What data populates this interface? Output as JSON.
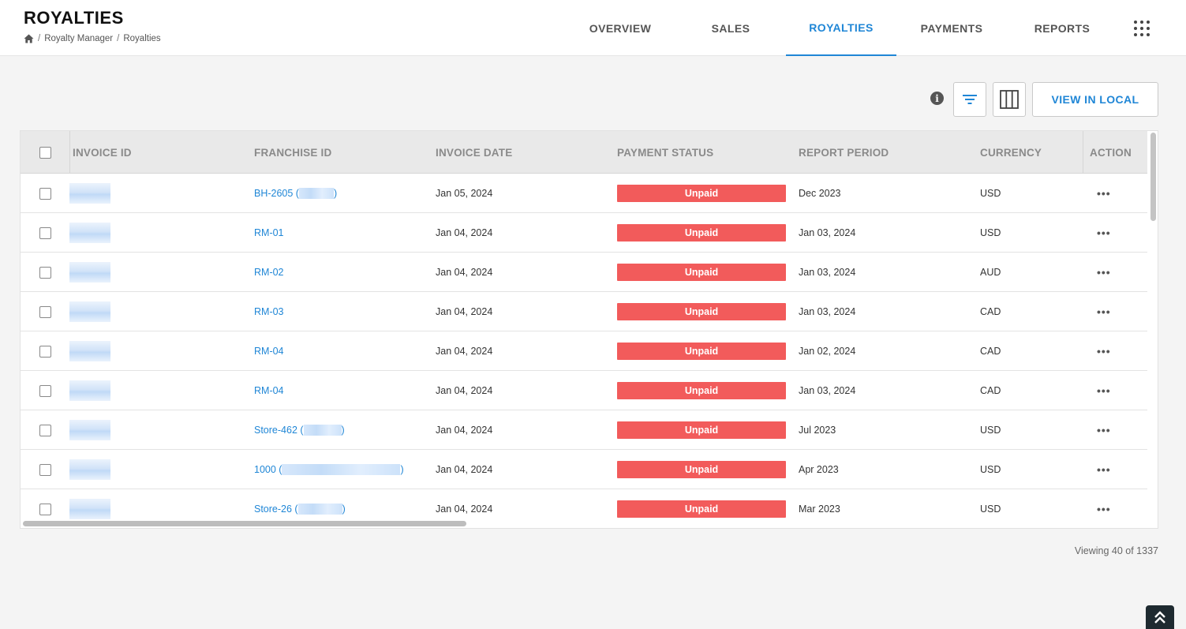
{
  "header": {
    "title": "ROYALTIES",
    "breadcrumb": [
      "Royalty Manager",
      "Royalties"
    ]
  },
  "nav": {
    "tabs": [
      {
        "label": "OVERVIEW",
        "active": false
      },
      {
        "label": "SALES",
        "active": false
      },
      {
        "label": "ROYALTIES",
        "active": true
      },
      {
        "label": "PAYMENTS",
        "active": false
      },
      {
        "label": "REPORTS",
        "active": false
      }
    ],
    "menu_icon": "apps-grid-icon"
  },
  "toolbar": {
    "info_icon": "info-icon",
    "filter_icon": "filter-icon",
    "columns_icon": "columns-icon",
    "view_local_label": "VIEW IN LOCAL"
  },
  "table": {
    "headers": {
      "invoice_id": "INVOICE ID",
      "franchise_id": "FRANCHISE ID",
      "invoice_date": "INVOICE DATE",
      "payment_status": "PAYMENT STATUS",
      "report_period": "REPORT PERIOD",
      "currency": "CURRENCY",
      "action": "ACTION"
    },
    "rows": [
      {
        "franchise": "BH-2605 (",
        "franchise_suffix": ")",
        "invoice_date": "Jan 05, 2024",
        "status": "Unpaid",
        "report_period": "Dec 2023",
        "currency": "USD",
        "action": "•••"
      },
      {
        "franchise": "RM-01",
        "franchise_suffix": "",
        "invoice_date": "Jan 04, 2024",
        "status": "Unpaid",
        "report_period": "Jan 03, 2024",
        "currency": "USD",
        "action": "•••"
      },
      {
        "franchise": "RM-02",
        "franchise_suffix": "",
        "invoice_date": "Jan 04, 2024",
        "status": "Unpaid",
        "report_period": "Jan 03, 2024",
        "currency": "AUD",
        "action": "•••"
      },
      {
        "franchise": "RM-03",
        "franchise_suffix": "",
        "invoice_date": "Jan 04, 2024",
        "status": "Unpaid",
        "report_period": "Jan 03, 2024",
        "currency": "CAD",
        "action": "•••"
      },
      {
        "franchise": "RM-04",
        "franchise_suffix": "",
        "invoice_date": "Jan 04, 2024",
        "status": "Unpaid",
        "report_period": "Jan 02, 2024",
        "currency": "CAD",
        "action": "•••"
      },
      {
        "franchise": "RM-04",
        "franchise_suffix": "",
        "invoice_date": "Jan 04, 2024",
        "status": "Unpaid",
        "report_period": "Jan 03, 2024",
        "currency": "CAD",
        "action": "•••"
      },
      {
        "franchise": "Store-462 (",
        "franchise_suffix": ")",
        "invoice_date": "Jan 04, 2024",
        "status": "Unpaid",
        "report_period": "Jul 2023",
        "currency": "USD",
        "action": "•••"
      },
      {
        "franchise": "1000 (",
        "franchise_suffix": ")",
        "invoice_date": "Jan 04, 2024",
        "status": "Unpaid",
        "report_period": "Apr 2023",
        "currency": "USD",
        "action": "•••"
      },
      {
        "franchise": "Store-26 (",
        "franchise_suffix": ")",
        "invoice_date": "Jan 04, 2024",
        "status": "Unpaid",
        "report_period": "Mar 2023",
        "currency": "USD",
        "action": "•••"
      }
    ]
  },
  "footer": {
    "viewing": "Viewing 40 of 1337",
    "scroll_top_icon": "double-chevron-up-icon"
  },
  "colors": {
    "accent": "#1f86d6",
    "unpaid": "#f25b5b"
  }
}
